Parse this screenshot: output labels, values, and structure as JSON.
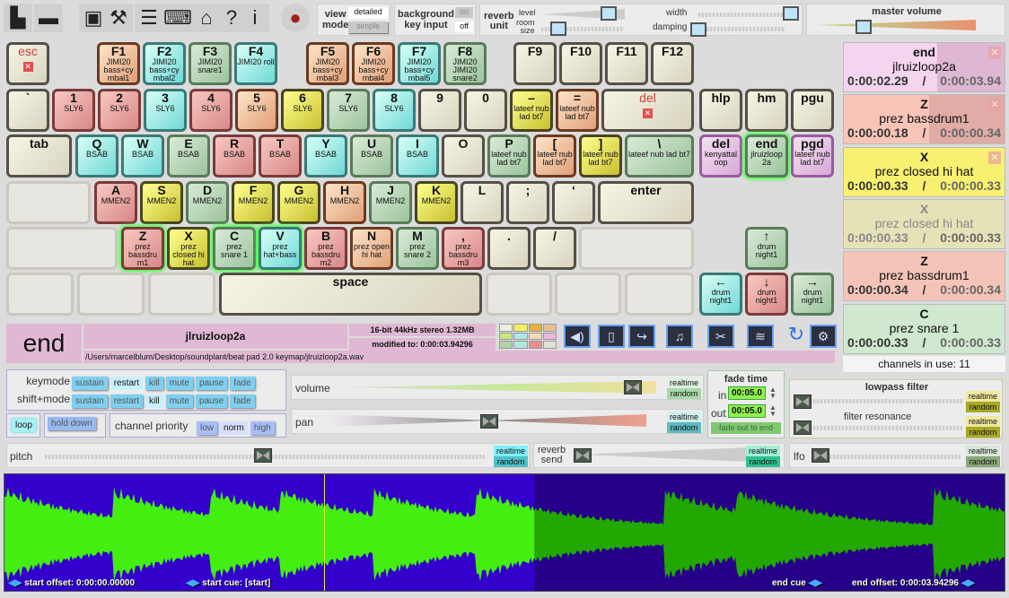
{
  "toolbar": {
    "icons": [
      "new-file-icon",
      "open-folder-icon",
      "save-audio-icon",
      "tools-icon",
      "notepad-icon",
      "keyboard-export-icon",
      "home-icon",
      "help-icon",
      "info-icon",
      "record-icon"
    ],
    "view_mode": {
      "label1": "view",
      "label2": "mode",
      "detailed": "detailed",
      "simple": "simple"
    },
    "bg_key": {
      "label1": "background",
      "label2": "key input",
      "on": "on",
      "off": "off"
    },
    "reverb": {
      "label1": "reverb",
      "label2": "unit",
      "level": "level",
      "room": "room",
      "size": "size",
      "width": "width",
      "damping": "damping"
    },
    "master_volume": "master volume"
  },
  "keyboard": {
    "rows": [
      [
        {
          "k": "esc",
          "s": "",
          "c": "esc"
        },
        {
          "k": "F1",
          "s": "JIMI20 bass+cy mbal1",
          "c": "peach"
        },
        {
          "k": "F2",
          "s": "JIMI20 bass+cy mbal2",
          "c": "cyan"
        },
        {
          "k": "F3",
          "s": "JIMI20 snare1",
          "c": "green"
        },
        {
          "k": "F4",
          "s": "JIMI20 roll",
          "c": "cyan"
        },
        {
          "k": "F5",
          "s": "JIMI20 bass+cy mbal3",
          "c": "peach"
        },
        {
          "k": "F6",
          "s": "JIMI20 bass+cy mbal4",
          "c": "peach"
        },
        {
          "k": "F7",
          "s": "JIMI20 bass+cy mbal5",
          "c": "cyan"
        },
        {
          "k": "F8",
          "s": "JIMI20 JIMI20 snare2",
          "c": "green"
        },
        {
          "k": "F9",
          "s": "",
          "c": "blank"
        },
        {
          "k": "F10",
          "s": "",
          "c": "blank"
        },
        {
          "k": "F11",
          "s": "",
          "c": "blank"
        },
        {
          "k": "F12",
          "s": "",
          "c": "blank"
        }
      ],
      [
        {
          "k": "`",
          "s": "",
          "c": "blank"
        },
        {
          "k": "1",
          "s": "SLY6",
          "c": "red"
        },
        {
          "k": "2",
          "s": "SLY6",
          "c": "red"
        },
        {
          "k": "3",
          "s": "SLY6",
          "c": "cyan"
        },
        {
          "k": "4",
          "s": "SLY6",
          "c": "red"
        },
        {
          "k": "5",
          "s": "SLY6",
          "c": "peach"
        },
        {
          "k": "6",
          "s": "SLY6",
          "c": "yellow"
        },
        {
          "k": "7",
          "s": "SLY6",
          "c": "green"
        },
        {
          "k": "8",
          "s": "SLY6",
          "c": "cyan"
        },
        {
          "k": "9",
          "s": "",
          "c": "blank"
        },
        {
          "k": "0",
          "s": "",
          "c": "blank"
        },
        {
          "k": "–",
          "s": "lateef nub lad bt7",
          "c": "yellow"
        },
        {
          "k": "=",
          "s": "lateef nub lad bt7",
          "c": "peach"
        },
        {
          "k": "del",
          "s": "",
          "c": "del"
        },
        {
          "k": "hlp",
          "s": "",
          "c": "blank"
        },
        {
          "k": "hm",
          "s": "",
          "c": "blank"
        },
        {
          "k": "pgu",
          "s": "",
          "c": "blank"
        }
      ],
      [
        {
          "k": "tab",
          "s": "",
          "c": "blank"
        },
        {
          "k": "Q",
          "s": "BSAB",
          "c": "cyan"
        },
        {
          "k": "W",
          "s": "BSAB",
          "c": "cyan"
        },
        {
          "k": "E",
          "s": "BSAB",
          "c": "green"
        },
        {
          "k": "R",
          "s": "BSAB",
          "c": "red"
        },
        {
          "k": "T",
          "s": "BSAB",
          "c": "red"
        },
        {
          "k": "Y",
          "s": "BSAB",
          "c": "cyan"
        },
        {
          "k": "U",
          "s": "BSAB",
          "c": "green"
        },
        {
          "k": "I",
          "s": "BSAB",
          "c": "cyan"
        },
        {
          "k": "O",
          "s": "",
          "c": "blank"
        },
        {
          "k": "P",
          "s": "lateef nub lad bt7",
          "c": "green"
        },
        {
          "k": "[",
          "s": "lateef nub lad bt7",
          "c": "peach"
        },
        {
          "k": "]",
          "s": "lateef nub lad bt7",
          "c": "yellow"
        },
        {
          "k": "\\",
          "s": "lateef nub lad bt7",
          "c": "green"
        },
        {
          "k": "del",
          "s": "kenyattal oop",
          "c": "pink"
        },
        {
          "k": "end",
          "s": "jlruizloop 2a",
          "c": "green glow"
        },
        {
          "k": "pgd",
          "s": "lateef nub lad bt7",
          "c": "pink"
        }
      ],
      [
        {
          "k": "",
          "s": "",
          "c": "empty"
        },
        {
          "k": "A",
          "s": "MMEN2",
          "c": "red"
        },
        {
          "k": "S",
          "s": "MMEN2",
          "c": "yellow"
        },
        {
          "k": "D",
          "s": "MMEN2",
          "c": "green"
        },
        {
          "k": "F",
          "s": "MMEN2",
          "c": "yellow"
        },
        {
          "k": "G",
          "s": "MMEN2",
          "c": "yellow"
        },
        {
          "k": "H",
          "s": "MMEN2",
          "c": "peach"
        },
        {
          "k": "J",
          "s": "MMEN2",
          "c": "green"
        },
        {
          "k": "K",
          "s": "MMEN2",
          "c": "yellow"
        },
        {
          "k": "L",
          "s": "",
          "c": "blank"
        },
        {
          "k": ";",
          "s": "",
          "c": "blank"
        },
        {
          "k": "‘",
          "s": "",
          "c": "blank"
        },
        {
          "k": "enter",
          "s": "",
          "c": "blank"
        }
      ],
      [
        {
          "k": "",
          "s": "",
          "c": "empty"
        },
        {
          "k": "Z",
          "s": "prez bassdru m1",
          "c": "red glow"
        },
        {
          "k": "X",
          "s": "prez closed hi hat",
          "c": "yellow"
        },
        {
          "k": "C",
          "s": "prez snare 1",
          "c": "green glow"
        },
        {
          "k": "V",
          "s": "prez hat+bass",
          "c": "cyan glow"
        },
        {
          "k": "B",
          "s": "prez bassdru m2",
          "c": "red"
        },
        {
          "k": "N",
          "s": "prez open hi hat",
          "c": "peach"
        },
        {
          "k": "M",
          "s": "prez snare 2",
          "c": "green"
        },
        {
          "k": ",",
          "s": "prez bassdru m3",
          "c": "red"
        },
        {
          "k": ".",
          "s": "",
          "c": "blank"
        },
        {
          "k": "/",
          "s": "",
          "c": "blank"
        },
        {
          "k": "",
          "s": "",
          "c": "empty"
        },
        {
          "k": "↑",
          "s": "drum night1",
          "c": "green"
        }
      ],
      [
        {
          "k": "",
          "s": "",
          "c": "empty"
        },
        {
          "k": "",
          "s": "",
          "c": "empty"
        },
        {
          "k": "",
          "s": "",
          "c": "empty"
        },
        {
          "k": "space",
          "s": "",
          "c": "blank"
        },
        {
          "k": "",
          "s": "",
          "c": "empty"
        },
        {
          "k": "",
          "s": "",
          "c": "empty"
        },
        {
          "k": "",
          "s": "",
          "c": "empty"
        },
        {
          "k": "←",
          "s": "drum night1",
          "c": "cyan"
        },
        {
          "k": "↓",
          "s": "drum night1",
          "c": "red"
        },
        {
          "k": "→",
          "s": "drum night1",
          "c": "green"
        }
      ]
    ]
  },
  "channels": [
    {
      "key": "end",
      "name": "jlruizloop2a",
      "elapsed": "0:00:02.29",
      "total": "0:00:03.94",
      "color": "#f4d4ee",
      "progress": 0.58
    },
    {
      "key": "Z",
      "name": "prez bassdrum1",
      "elapsed": "0:00:00.18",
      "total": "0:00:00.34",
      "color": "#f8c4b8",
      "progress": 0.53
    },
    {
      "key": "X",
      "name": "prez closed hi hat",
      "elapsed": "0:00:00.33",
      "total": "0:00:00.33",
      "color": "#f8f070",
      "progress": 1
    },
    {
      "key": "X",
      "name": "prez closed hi hat",
      "elapsed": "0:00:00.33",
      "total": "0:00:00.33",
      "color": "#e6e2b8",
      "progress": 1,
      "faded": true
    },
    {
      "key": "Z",
      "name": "prez bassdrum1",
      "elapsed": "0:00:00.34",
      "total": "0:00:00.34",
      "color": "#f4c4b8",
      "progress": 1
    },
    {
      "key": "C",
      "name": "prez snare 1",
      "elapsed": "0:00:00.33",
      "total": "0:00:00.33",
      "color": "#cfe8cf",
      "progress": 1
    }
  ],
  "channels_in_use": "channels in use: 11",
  "sample": {
    "key": "end",
    "name": "jlruizloop2a",
    "format": "16-bit 44kHz stereo 1.32MB",
    "modified": "modified to: 0:00:03.94296",
    "path": "/Users/marcelblum/Desktop/soundplant/beat pad 2.0 keymap/jlruizloop2a.wav"
  },
  "sample_icons": [
    "speaker-folder-icon",
    "file-icon",
    "export-arrow-icon",
    "music-note-icon",
    "scissors-icon",
    "waveform-icon",
    "refresh-icon",
    "settings-disk-icon"
  ],
  "palette": [
    "#f0eedc",
    "#f0f060",
    "#e8b040",
    "#e8c090",
    "#c8e880",
    "#a8e8e8",
    "#f8d8b8",
    "#e8b8e0",
    "#b0d0a8",
    "#b0e8e0",
    "#e89090",
    "#e0e0d8"
  ],
  "controls": {
    "keymode": "keymode",
    "shiftmode": "shift+mode",
    "modes": [
      "sustain",
      "restart",
      "kill",
      "mute",
      "pause",
      "fade"
    ],
    "keymode_selected": "restart",
    "shift_selected": "kill",
    "loop": "loop",
    "hold_down": "hold down",
    "channel_priority": "channel priority",
    "priorities": [
      "low",
      "norm",
      "high"
    ],
    "priority_selected": "norm",
    "volume": "volume",
    "pan": "pan",
    "pitch": "pitch",
    "reverb_send1": "reverb",
    "reverb_send2": "send",
    "realtime": "realtime",
    "random": "random",
    "fade_time": "fade time",
    "fade_in_label": "in",
    "fade_out_label": "out",
    "fade_in": "00:05.0",
    "fade_out": "00:05.0",
    "fade_out_to_end": "fade out to end",
    "lowpass": "lowpass filter",
    "resonance": "filter resonance",
    "lfo": "lfo"
  },
  "waveform": {
    "start_offset": "start offset: 0:00:00.00000",
    "start_cue": "start cue: [start]",
    "end_cue": "end cue",
    "end_offset": "end offset: 0:00:03.94296",
    "played_fraction": 0.53,
    "playhead_fraction": 0.32
  }
}
